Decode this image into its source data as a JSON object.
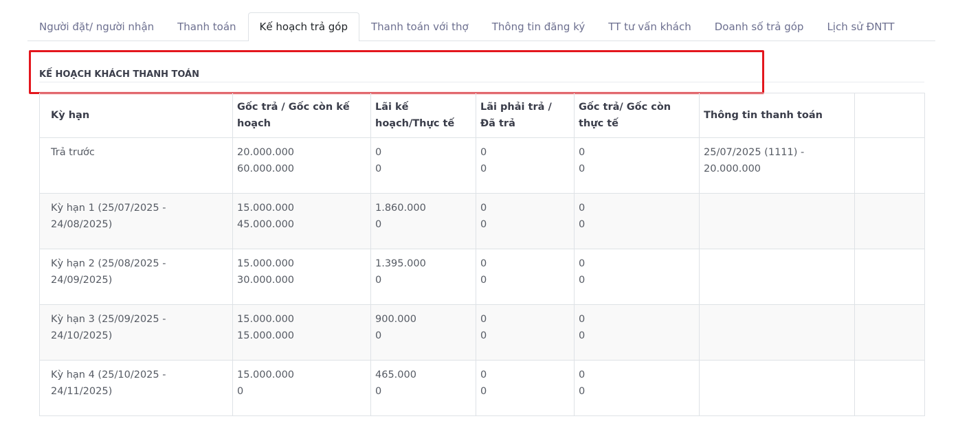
{
  "tabs": [
    {
      "label": "Người đặt/ người nhận",
      "active": false
    },
    {
      "label": "Thanh toán",
      "active": false
    },
    {
      "label": "Kế hoạch trả góp",
      "active": true
    },
    {
      "label": "Thanh toán với thợ",
      "active": false
    },
    {
      "label": "Thông tin đăng ký",
      "active": false
    },
    {
      "label": "TT tư vấn khách",
      "active": false
    },
    {
      "label": "Doanh số trả góp",
      "active": false
    },
    {
      "label": "Lịch sử ĐNTT",
      "active": false
    }
  ],
  "section": {
    "title": "KẾ HOẠCH KHÁCH THANH TOÁN"
  },
  "colors": {
    "highlight": "#e3161d",
    "border": "#dee2e6"
  },
  "table": {
    "headers": [
      "Kỳ hạn",
      "Gốc trả / Gốc còn kế hoạch",
      "Lãi kế hoạch/Thực tế",
      "Lãi phải trả / Đã trả",
      "Gốc trả/ Gốc còn thực tế",
      "Thông tin thanh toán",
      ""
    ],
    "rows": [
      {
        "term": "Trả trước",
        "goc_kh": [
          "20.000.000",
          "60.000.000"
        ],
        "lai_kh": [
          "0",
          "0"
        ],
        "lai_tra": [
          "0",
          "0"
        ],
        "goc_tt": [
          "0",
          "0"
        ],
        "info": "25/07/2025 (1111) - 20.000.000"
      },
      {
        "term": "Kỳ hạn 1 (25/07/2025 - 24/08/2025)",
        "goc_kh": [
          "15.000.000",
          "45.000.000"
        ],
        "lai_kh": [
          "1.860.000",
          "0"
        ],
        "lai_tra": [
          "0",
          "0"
        ],
        "goc_tt": [
          "0",
          "0"
        ],
        "info": ""
      },
      {
        "term": "Kỳ hạn 2 (25/08/2025 - 24/09/2025)",
        "goc_kh": [
          "15.000.000",
          "30.000.000"
        ],
        "lai_kh": [
          "1.395.000",
          "0"
        ],
        "lai_tra": [
          "0",
          "0"
        ],
        "goc_tt": [
          "0",
          "0"
        ],
        "info": ""
      },
      {
        "term": "Kỳ hạn 3 (25/09/2025 - 24/10/2025)",
        "goc_kh": [
          "15.000.000",
          "15.000.000"
        ],
        "lai_kh": [
          "900.000",
          "0"
        ],
        "lai_tra": [
          "0",
          "0"
        ],
        "goc_tt": [
          "0",
          "0"
        ],
        "info": ""
      },
      {
        "term": "Kỳ hạn 4 (25/10/2025 - 24/11/2025)",
        "goc_kh": [
          "15.000.000",
          "0"
        ],
        "lai_kh": [
          "465.000",
          "0"
        ],
        "lai_tra": [
          "0",
          "0"
        ],
        "goc_tt": [
          "0",
          "0"
        ],
        "info": ""
      }
    ]
  }
}
